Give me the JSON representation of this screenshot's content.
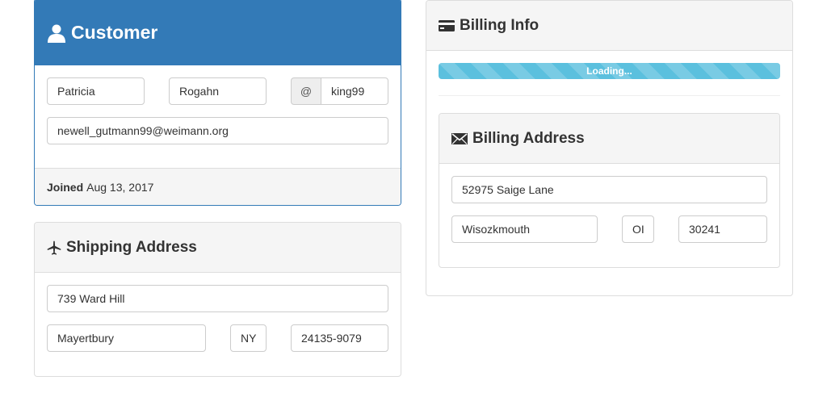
{
  "customer": {
    "title": "Customer",
    "first_name": "Patricia",
    "last_name": "Rogahn",
    "username_prefix": "@",
    "username": "king99",
    "email": "newell_gutmann99@weimann.org",
    "joined_label": "Joined",
    "joined_date": "Aug 13, 2017"
  },
  "shipping": {
    "title": "Shipping Address",
    "street": "739 Ward Hill",
    "city": "Mayertbury",
    "state": "NY",
    "zip": "24135-9079"
  },
  "billing": {
    "title": "Billing Info",
    "progress_label": "Loading...",
    "progress_fraction": 1.0,
    "address": {
      "title": "Billing Address",
      "street": "52975 Saige Lane",
      "city": "Wisozkmouth",
      "state": "OI",
      "zip": "30241"
    }
  },
  "icons": {
    "customer": "user-icon",
    "shipping": "plane-icon",
    "billing": "credit-card-icon",
    "billing_address": "envelope-icon"
  },
  "colors": {
    "primary": "#337ab7",
    "progress": "#5bc0de"
  }
}
